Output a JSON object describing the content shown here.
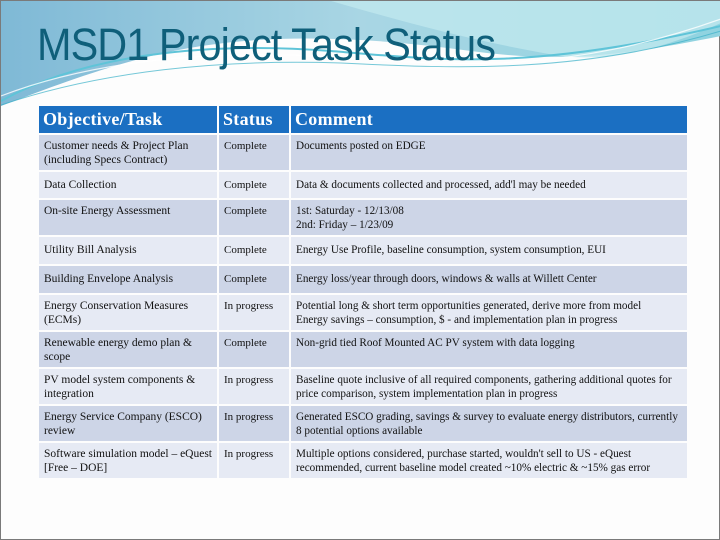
{
  "slide": {
    "title": "MSD1 Project Task Status"
  },
  "table": {
    "headers": [
      "Objective/Task",
      "Status",
      "Comment"
    ],
    "rows": [
      {
        "task": "Customer needs & Project Plan (including Specs Contract)",
        "status": "Complete",
        "comment": [
          "Documents posted on EDGE"
        ]
      },
      {
        "task": "Data Collection",
        "status": "Complete",
        "comment": [
          "Data & documents collected and processed, add'l may be needed"
        ]
      },
      {
        "task": "On-site Energy Assessment",
        "status": "Complete",
        "comment": [
          "1st: Saturday - 12/13/08",
          "2nd: Friday – 1/23/09"
        ]
      },
      {
        "task": "Utility Bill Analysis",
        "status": "Complete",
        "comment": [
          "Energy Use Profile, baseline consumption, system consumption, EUI"
        ]
      },
      {
        "task": "Building Envelope Analysis",
        "status": "Complete",
        "comment": [
          "Energy loss/year through doors, windows & walls at Willett Center"
        ]
      },
      {
        "task": "Energy Conservation Measures (ECMs)",
        "status": "In progress",
        "comment": [
          "Potential long & short term opportunities generated, derive more from model",
          "Energy savings – consumption, $ - and implementation plan in progress"
        ]
      },
      {
        "task": "Renewable energy demo plan & scope",
        "status": "Complete",
        "comment": [
          "Non-grid tied Roof Mounted AC PV system with data logging"
        ]
      },
      {
        "task": "PV model system components & integration",
        "status": "In progress",
        "comment": [
          "Baseline quote inclusive of all required components, gathering additional quotes for price comparison, system implementation plan in progress"
        ]
      },
      {
        "task": "Energy Service Company (ESCO) review",
        "status": "In progress",
        "comment": [
          "Generated ESCO grading, savings & survey to evaluate energy distributors, currently 8 potential options available"
        ]
      },
      {
        "task": "Software simulation model – eQuest [Free – DOE]",
        "status": "In progress",
        "comment": [
          "Multiple options considered, purchase started, wouldn't sell to US - eQuest recommended, current baseline model created ~10% electric & ~15% gas error"
        ]
      }
    ]
  },
  "colors": {
    "title": "#0f5f7a",
    "header_bg": "#1b6fc2",
    "row_odd": "#cdd5e7",
    "row_even": "#e6eaf4"
  }
}
